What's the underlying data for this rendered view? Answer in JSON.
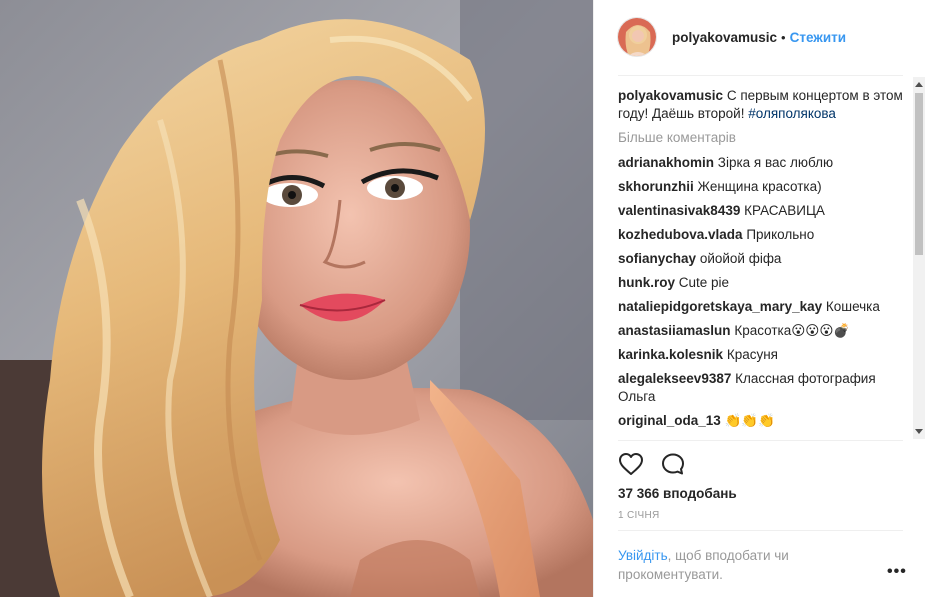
{
  "post": {
    "username": "polyakovamusic",
    "separator": "•",
    "follow_label": "Стежити",
    "caption": {
      "username": "polyakovamusic",
      "text": "С первым концертом в этом году! Даёшь второй!",
      "hashtag": "#оляполякова"
    },
    "load_more_label": "Більше коментарів",
    "comments": [
      {
        "user": "adrianakhomin",
        "text": "Зірка я вас люблю"
      },
      {
        "user": "skhorunzhii",
        "text": "Женщина красотка)"
      },
      {
        "user": "valentinasivak8439",
        "text": "КРАСАВИЦА"
      },
      {
        "user": "kozhedubova.vlada",
        "text": "Прикольно"
      },
      {
        "user": "sofianychay",
        "text": "ойойой фіфа"
      },
      {
        "user": "hunk.roy",
        "text": "Cute pie"
      },
      {
        "user": "nataliepidgoretskaya_mary_kay",
        "text": "Кошечка"
      },
      {
        "user": "anastasiiamaslun",
        "text": "Красотка😮😮😮💣"
      },
      {
        "user": "karinka.kolesnik",
        "text": "Красуня"
      },
      {
        "user": "alegalekseev9387",
        "text": "Классная фотография Ольга"
      },
      {
        "user": "original_oda_13",
        "text": "👏👏👏"
      }
    ],
    "likes_label": "37 366 вподобань",
    "date_label": "1 СІЧНЯ",
    "login_link": "Увійдіть",
    "login_text": ", щоб вподобати чи прокоментувати.",
    "more_options": "•••"
  },
  "icons": {
    "like": "heart-outline-icon",
    "comment": "speech-bubble-icon",
    "more": "more-options-icon"
  },
  "colors": {
    "link": "#3897f0",
    "muted": "#999999",
    "hashtag": "#003569"
  }
}
